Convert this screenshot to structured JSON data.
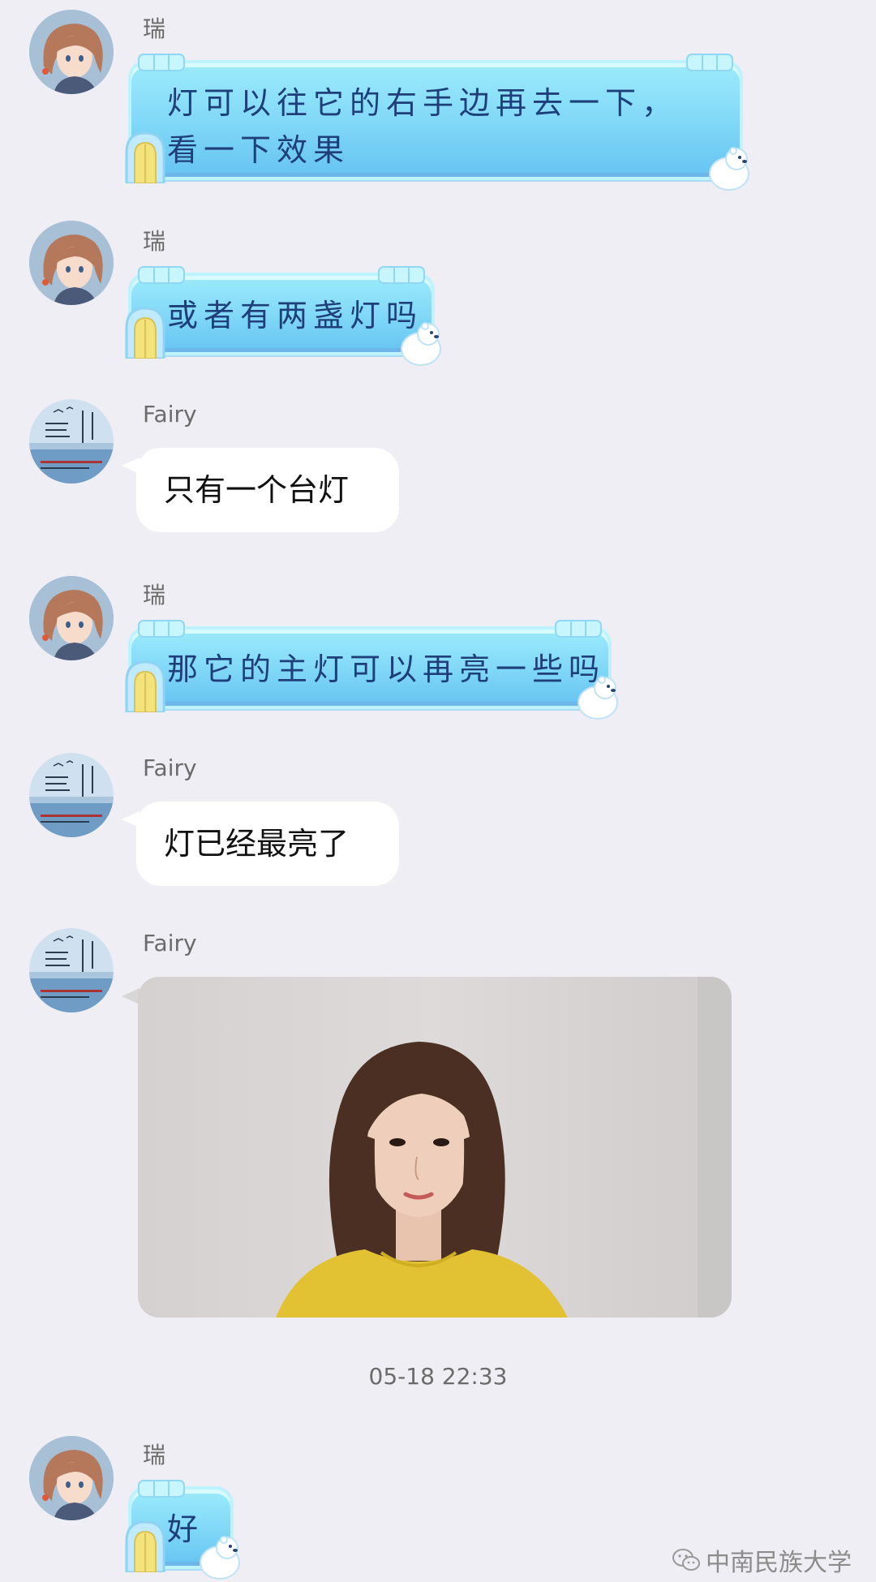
{
  "messages": [
    {
      "sender": "瑞",
      "text": "灯可以往它的右手边再去一下，看一下效果"
    },
    {
      "sender": "瑞",
      "text": "或者有两盏灯吗"
    },
    {
      "sender": "Fairy",
      "text": "只有一个台灯"
    },
    {
      "sender": "瑞",
      "text": "那它的主灯可以再亮一些吗"
    },
    {
      "sender": "Fairy",
      "text": "灯已经最亮了"
    },
    {
      "sender": "Fairy",
      "image": "photo-of-woman-in-yellow-top"
    },
    {
      "sender": "瑞",
      "text": "好"
    }
  ],
  "timestamp": "05-18 22:33",
  "watermark": "中南民族大学",
  "colors": {
    "background": "#eeeef4",
    "ice_bubble": "#7fd7f7",
    "ice_text": "#1f3f7a",
    "white_bubble": "#ffffff",
    "meta_text": "#6b6b6b"
  },
  "icons": {
    "rui_avatar": "anime-girl-avatar",
    "fairy_avatar": "sea-poster-avatar",
    "watermark": "wechat-icon"
  }
}
